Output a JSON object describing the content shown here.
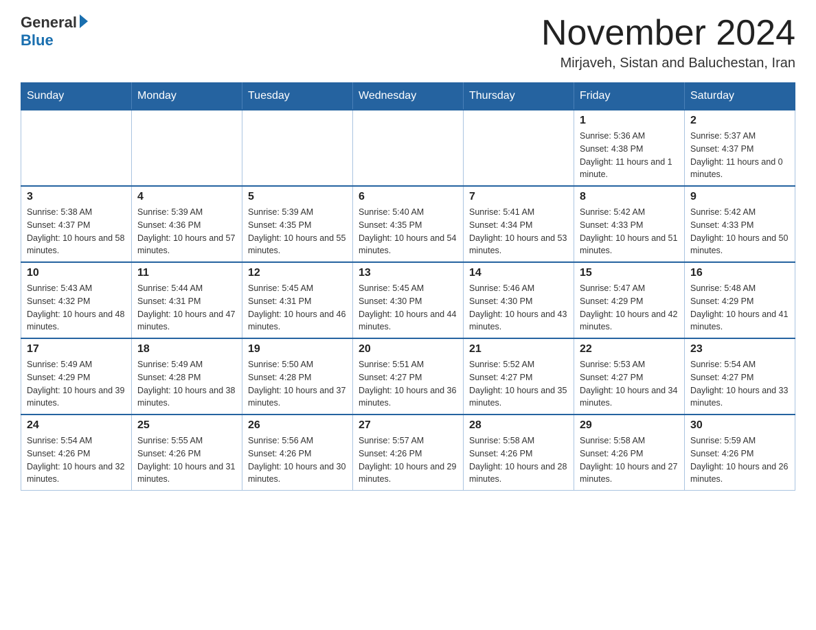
{
  "logo": {
    "general": "General",
    "blue": "Blue"
  },
  "header": {
    "month_year": "November 2024",
    "location": "Mirjaveh, Sistan and Baluchestan, Iran"
  },
  "weekdays": [
    "Sunday",
    "Monday",
    "Tuesday",
    "Wednesday",
    "Thursday",
    "Friday",
    "Saturday"
  ],
  "weeks": [
    [
      {
        "day": "",
        "info": ""
      },
      {
        "day": "",
        "info": ""
      },
      {
        "day": "",
        "info": ""
      },
      {
        "day": "",
        "info": ""
      },
      {
        "day": "",
        "info": ""
      },
      {
        "day": "1",
        "info": "Sunrise: 5:36 AM\nSunset: 4:38 PM\nDaylight: 11 hours and 1 minute."
      },
      {
        "day": "2",
        "info": "Sunrise: 5:37 AM\nSunset: 4:37 PM\nDaylight: 11 hours and 0 minutes."
      }
    ],
    [
      {
        "day": "3",
        "info": "Sunrise: 5:38 AM\nSunset: 4:37 PM\nDaylight: 10 hours and 58 minutes."
      },
      {
        "day": "4",
        "info": "Sunrise: 5:39 AM\nSunset: 4:36 PM\nDaylight: 10 hours and 57 minutes."
      },
      {
        "day": "5",
        "info": "Sunrise: 5:39 AM\nSunset: 4:35 PM\nDaylight: 10 hours and 55 minutes."
      },
      {
        "day": "6",
        "info": "Sunrise: 5:40 AM\nSunset: 4:35 PM\nDaylight: 10 hours and 54 minutes."
      },
      {
        "day": "7",
        "info": "Sunrise: 5:41 AM\nSunset: 4:34 PM\nDaylight: 10 hours and 53 minutes."
      },
      {
        "day": "8",
        "info": "Sunrise: 5:42 AM\nSunset: 4:33 PM\nDaylight: 10 hours and 51 minutes."
      },
      {
        "day": "9",
        "info": "Sunrise: 5:42 AM\nSunset: 4:33 PM\nDaylight: 10 hours and 50 minutes."
      }
    ],
    [
      {
        "day": "10",
        "info": "Sunrise: 5:43 AM\nSunset: 4:32 PM\nDaylight: 10 hours and 48 minutes."
      },
      {
        "day": "11",
        "info": "Sunrise: 5:44 AM\nSunset: 4:31 PM\nDaylight: 10 hours and 47 minutes."
      },
      {
        "day": "12",
        "info": "Sunrise: 5:45 AM\nSunset: 4:31 PM\nDaylight: 10 hours and 46 minutes."
      },
      {
        "day": "13",
        "info": "Sunrise: 5:45 AM\nSunset: 4:30 PM\nDaylight: 10 hours and 44 minutes."
      },
      {
        "day": "14",
        "info": "Sunrise: 5:46 AM\nSunset: 4:30 PM\nDaylight: 10 hours and 43 minutes."
      },
      {
        "day": "15",
        "info": "Sunrise: 5:47 AM\nSunset: 4:29 PM\nDaylight: 10 hours and 42 minutes."
      },
      {
        "day": "16",
        "info": "Sunrise: 5:48 AM\nSunset: 4:29 PM\nDaylight: 10 hours and 41 minutes."
      }
    ],
    [
      {
        "day": "17",
        "info": "Sunrise: 5:49 AM\nSunset: 4:29 PM\nDaylight: 10 hours and 39 minutes."
      },
      {
        "day": "18",
        "info": "Sunrise: 5:49 AM\nSunset: 4:28 PM\nDaylight: 10 hours and 38 minutes."
      },
      {
        "day": "19",
        "info": "Sunrise: 5:50 AM\nSunset: 4:28 PM\nDaylight: 10 hours and 37 minutes."
      },
      {
        "day": "20",
        "info": "Sunrise: 5:51 AM\nSunset: 4:27 PM\nDaylight: 10 hours and 36 minutes."
      },
      {
        "day": "21",
        "info": "Sunrise: 5:52 AM\nSunset: 4:27 PM\nDaylight: 10 hours and 35 minutes."
      },
      {
        "day": "22",
        "info": "Sunrise: 5:53 AM\nSunset: 4:27 PM\nDaylight: 10 hours and 34 minutes."
      },
      {
        "day": "23",
        "info": "Sunrise: 5:54 AM\nSunset: 4:27 PM\nDaylight: 10 hours and 33 minutes."
      }
    ],
    [
      {
        "day": "24",
        "info": "Sunrise: 5:54 AM\nSunset: 4:26 PM\nDaylight: 10 hours and 32 minutes."
      },
      {
        "day": "25",
        "info": "Sunrise: 5:55 AM\nSunset: 4:26 PM\nDaylight: 10 hours and 31 minutes."
      },
      {
        "day": "26",
        "info": "Sunrise: 5:56 AM\nSunset: 4:26 PM\nDaylight: 10 hours and 30 minutes."
      },
      {
        "day": "27",
        "info": "Sunrise: 5:57 AM\nSunset: 4:26 PM\nDaylight: 10 hours and 29 minutes."
      },
      {
        "day": "28",
        "info": "Sunrise: 5:58 AM\nSunset: 4:26 PM\nDaylight: 10 hours and 28 minutes."
      },
      {
        "day": "29",
        "info": "Sunrise: 5:58 AM\nSunset: 4:26 PM\nDaylight: 10 hours and 27 minutes."
      },
      {
        "day": "30",
        "info": "Sunrise: 5:59 AM\nSunset: 4:26 PM\nDaylight: 10 hours and 26 minutes."
      }
    ]
  ]
}
